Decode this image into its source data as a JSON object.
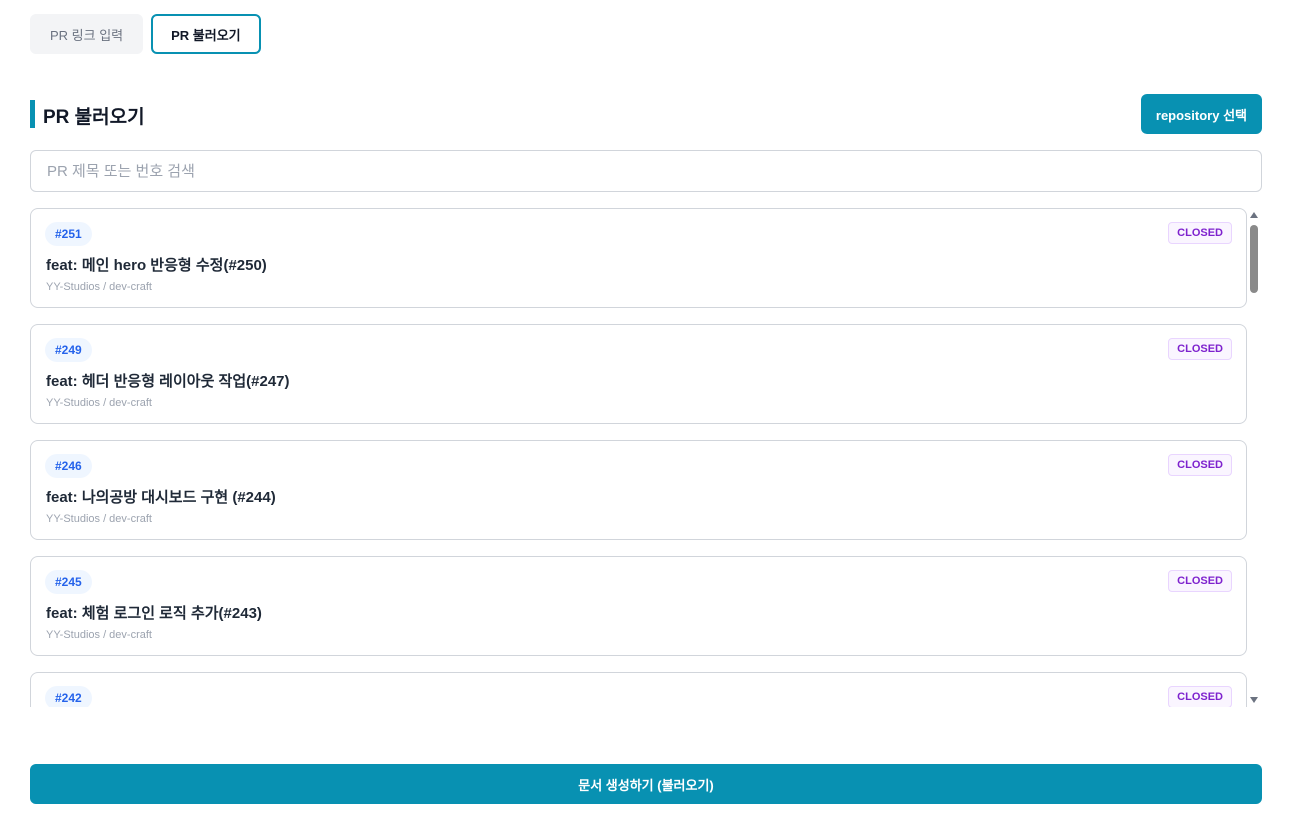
{
  "tabs": [
    {
      "label": "PR 링크 입력"
    },
    {
      "label": "PR 불러오기"
    }
  ],
  "section": {
    "title": "PR 불러오기",
    "repo_button_label": "repository 선택"
  },
  "search": {
    "placeholder": "PR 제목 또는 번호 검색",
    "value": ""
  },
  "prs": [
    {
      "number": "#251",
      "title": "feat: 메인 hero 반응형 수정(#250)",
      "repo": "YY-Studios / dev-craft",
      "status": "CLOSED"
    },
    {
      "number": "#249",
      "title": "feat: 헤더 반응형 레이아웃 작업(#247)",
      "repo": "YY-Studios / dev-craft",
      "status": "CLOSED"
    },
    {
      "number": "#246",
      "title": "feat: 나의공방 대시보드 구현 (#244)",
      "repo": "YY-Studios / dev-craft",
      "status": "CLOSED"
    },
    {
      "number": "#245",
      "title": "feat: 체험 로그인 로직 추가(#243)",
      "repo": "YY-Studios / dev-craft",
      "status": "CLOSED"
    },
    {
      "number": "#242",
      "title": "",
      "repo": "",
      "status": "CLOSED"
    }
  ],
  "generate_button_label": "문서 생성하기 (불러오기)",
  "colors": {
    "accent": "#0891b2",
    "pr_number_text": "#2563eb",
    "status_closed": "#7e22ce"
  }
}
